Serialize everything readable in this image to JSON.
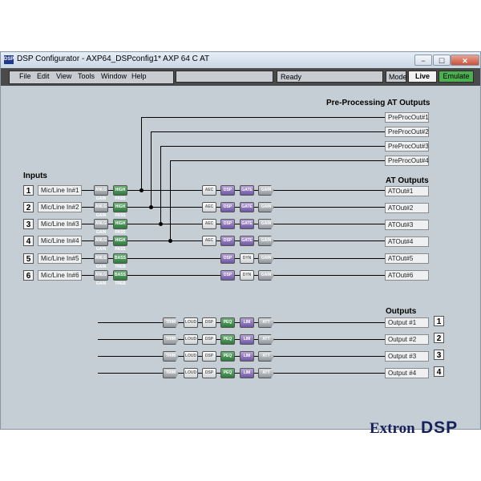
{
  "window": {
    "title": "DSP Configurator - AXP64_DSPconfig1* AXP 64 C AT",
    "app_icon": "DSP",
    "controls": {
      "minimize": "−",
      "maximize": "☐",
      "close": "✕"
    }
  },
  "menu": {
    "items": [
      "File",
      "Edit",
      "View",
      "Tools",
      "Window",
      "Help"
    ],
    "status": "Ready",
    "mode_label": "Mode",
    "live_label": "Live",
    "emulate_label": "Emulate",
    "emulate_color": "#4caf50"
  },
  "preproc": {
    "title": "Pre-Processing AT Outputs",
    "outputs": [
      "PreProcOut#1",
      "PreProcOut#2",
      "PreProcOut#3",
      "PreProcOut#4"
    ]
  },
  "inputs": {
    "title": "Inputs",
    "numbers": [
      "1",
      "2",
      "3",
      "4",
      "5",
      "6"
    ],
    "names": [
      "Mic/Line In#1",
      "Mic/Line In#2",
      "Mic/Line In#3",
      "Mic/Line In#4",
      "Mic/Line In#5",
      "Mic/Line In#6"
    ]
  },
  "at_outputs": {
    "title": "AT Outputs",
    "names": [
      "ATOut#1",
      "ATOut#2",
      "ATOut#3",
      "ATOut#4",
      "ATOut#5",
      "ATOut#6"
    ]
  },
  "outputs": {
    "title": "Outputs",
    "names": [
      "Output #1",
      "Output #2",
      "Output #3",
      "Output #4"
    ],
    "numbers": [
      "1",
      "2",
      "3",
      "4"
    ]
  },
  "blocks": {
    "input_gain": "ANLG GAIN",
    "high_pass": "HIGH PASS",
    "bass_treble": "BASS TREB",
    "aec": "AEC",
    "dsp": "DSP",
    "gate": "GATE",
    "gain": "GAIN",
    "dyn": "DYN",
    "trim": "TRIM",
    "loud": "LOUD",
    "peq": "PEQ",
    "lim": "LIM",
    "att": "ATT"
  },
  "logo": {
    "brand": "Extron",
    "product": "DSP"
  }
}
